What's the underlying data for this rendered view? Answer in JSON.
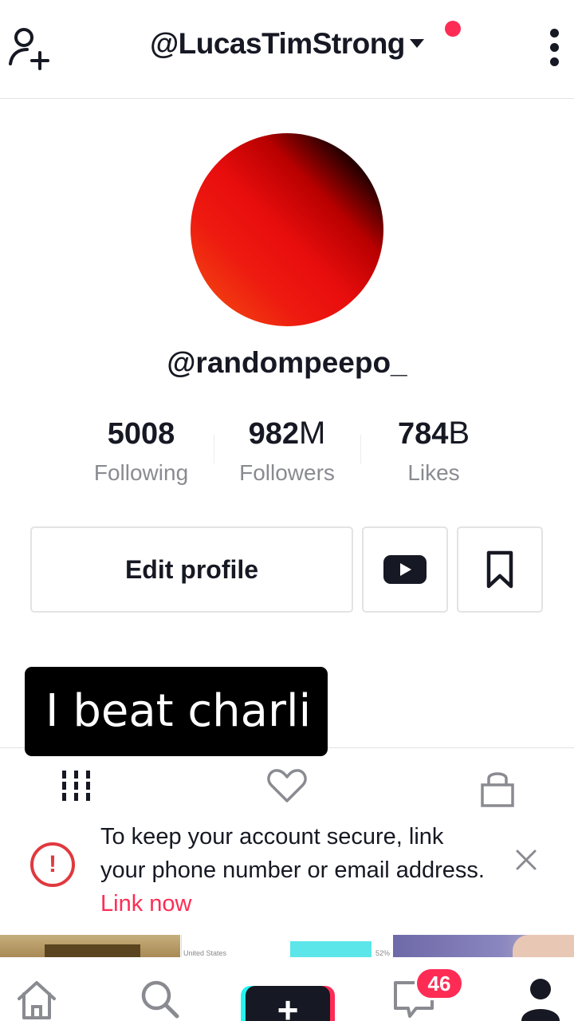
{
  "header": {
    "title": "@LucasTimStrong",
    "icons": {
      "add_user": "add-user-icon",
      "caret": "caret-down-icon",
      "more": "more-vertical-icon"
    },
    "notification_dot_color": "#fe2c55"
  },
  "profile": {
    "handle": "@randompeepo_",
    "stats": [
      {
        "value": "5008",
        "suffix": "",
        "label": "Following"
      },
      {
        "value": "982",
        "suffix": "M",
        "label": "Followers"
      },
      {
        "value": "784",
        "suffix": "B",
        "label": "Likes"
      }
    ]
  },
  "actions": {
    "edit_profile_label": "Edit profile",
    "icons": {
      "youtube": "youtube-icon",
      "bookmark": "bookmark-icon"
    }
  },
  "overlay": {
    "caption": "I beat charli"
  },
  "tabs": {
    "icons": [
      "grid-icon",
      "heart-icon",
      "lock-icon"
    ]
  },
  "security_banner": {
    "text": "To keep your account secure, link your phone number or email address.",
    "link_label": "Link now",
    "icons": {
      "warning": "warning-icon",
      "close": "close-icon"
    },
    "accent_color": "#e0393e"
  },
  "thumbnails": {
    "thumb2_text": "United States",
    "thumb2_value": "52%"
  },
  "bottom_nav": {
    "icons": [
      "home-icon",
      "search-icon",
      "create-icon",
      "inbox-icon",
      "profile-icon"
    ],
    "create_label": "+",
    "inbox_badge": "46"
  },
  "colors": {
    "accent": "#fe2c55",
    "cyan": "#25f4ee",
    "text": "#161823",
    "muted": "#8a8b91"
  }
}
